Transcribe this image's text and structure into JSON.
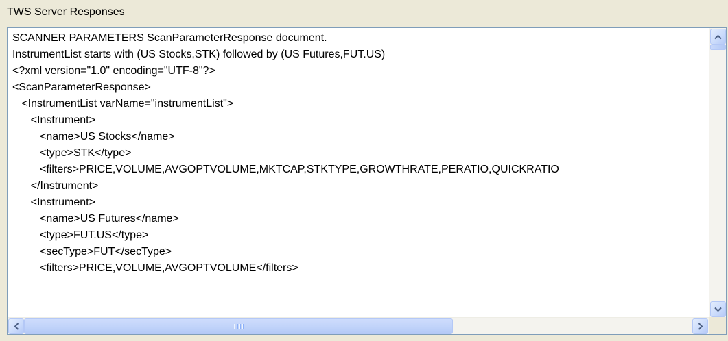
{
  "group": {
    "title": "TWS Server Responses"
  },
  "textarea": {
    "lines": [
      "SCANNER PARAMETERS ScanParameterResponse document.",
      "InstrumentList starts with (US Stocks,STK) followed by (US Futures,FUT.US)",
      "<?xml version=\"1.0\" encoding=\"UTF-8\"?>",
      "<ScanParameterResponse>",
      "   <InstrumentList varName=\"instrumentList\">",
      "      <Instrument>",
      "         <name>US Stocks</name>",
      "         <type>STK</type>",
      "         <filters>PRICE,VOLUME,AVGOPTVOLUME,MKTCAP,STKTYPE,GROWTHRATE,PERATIO,QUICKRATIO",
      "      </Instrument>",
      "      <Instrument>",
      "         <name>US Futures</name>",
      "         <type>FUT.US</type>",
      "         <secType>FUT</secType>",
      "         <filters>PRICE,VOLUME,AVGOPTVOLUME</filters>"
    ]
  },
  "scrollbars": {
    "vertical": {
      "up_icon": "arrow-up-icon",
      "down_icon": "arrow-down-icon",
      "position": 0.0
    },
    "horizontal": {
      "left_icon": "arrow-left-icon",
      "right_icon": "arrow-right-icon",
      "position": 0.0
    }
  },
  "colors": {
    "panel_bg": "#ECE9D8",
    "text_bg": "#FFFFFF",
    "border": "#7F9DB9",
    "scroll_button": "#C9DAFB",
    "arrow": "#4D6185"
  }
}
